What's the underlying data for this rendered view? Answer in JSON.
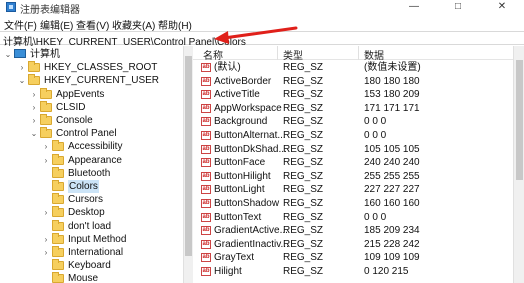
{
  "window": {
    "title": "注册表编辑器",
    "minimize": "—",
    "maximize": "□",
    "close": "✕"
  },
  "menu": [
    "文件(F)",
    "编辑(E)",
    "查看(V)",
    "收藏夹(A)",
    "帮助(H)"
  ],
  "address": "计算机\\HKEY_CURRENT_USER\\Control Panel\\Colors",
  "accent": {
    "selection": "#cce4f7",
    "arrow": "#e0201a"
  },
  "icons": {
    "computer": "computer-icon",
    "folder": "folder-icon",
    "value": "string-value-icon"
  },
  "tree": [
    {
      "label": "计算机",
      "expander": "⌄",
      "icon": "computer"
    },
    {
      "label": "HKEY_CLASSES_ROOT",
      "expander": "›",
      "icon": "folder"
    },
    {
      "label": "HKEY_CURRENT_USER",
      "expander": "⌄",
      "icon": "folder"
    },
    {
      "label": "AppEvents",
      "expander": "›",
      "icon": "folder"
    },
    {
      "label": "CLSID",
      "expander": "›",
      "icon": "folder"
    },
    {
      "label": "Console",
      "expander": "›",
      "icon": "folder"
    },
    {
      "label": "Control Panel",
      "expander": "⌄",
      "icon": "folder"
    },
    {
      "label": "Accessibility",
      "expander": "›",
      "icon": "folder"
    },
    {
      "label": "Appearance",
      "expander": "›",
      "icon": "folder"
    },
    {
      "label": "Bluetooth",
      "expander": "",
      "icon": "folder"
    },
    {
      "label": "Colors",
      "expander": "",
      "icon": "folder",
      "selected": true
    },
    {
      "label": "Cursors",
      "expander": "",
      "icon": "folder"
    },
    {
      "label": "Desktop",
      "expander": "›",
      "icon": "folder"
    },
    {
      "label": "don't load",
      "expander": "",
      "icon": "folder"
    },
    {
      "label": "Input Method",
      "expander": "›",
      "icon": "folder"
    },
    {
      "label": "International",
      "expander": "›",
      "icon": "folder"
    },
    {
      "label": "Keyboard",
      "expander": "",
      "icon": "folder"
    },
    {
      "label": "Mouse",
      "expander": "",
      "icon": "folder"
    }
  ],
  "columns": {
    "name": "名称",
    "type": "类型",
    "data": "数据"
  },
  "values": [
    {
      "name": "(默认)",
      "type": "REG_SZ",
      "data": "(数值未设置)"
    },
    {
      "name": "ActiveBorder",
      "type": "REG_SZ",
      "data": "180 180 180"
    },
    {
      "name": "ActiveTitle",
      "type": "REG_SZ",
      "data": "153 180 209"
    },
    {
      "name": "AppWorkspace",
      "type": "REG_SZ",
      "data": "171 171 171"
    },
    {
      "name": "Background",
      "type": "REG_SZ",
      "data": "0 0 0"
    },
    {
      "name": "ButtonAlternat...",
      "type": "REG_SZ",
      "data": "0 0 0"
    },
    {
      "name": "ButtonDkShad...",
      "type": "REG_SZ",
      "data": "105 105 105"
    },
    {
      "name": "ButtonFace",
      "type": "REG_SZ",
      "data": "240 240 240"
    },
    {
      "name": "ButtonHilight",
      "type": "REG_SZ",
      "data": "255 255 255"
    },
    {
      "name": "ButtonLight",
      "type": "REG_SZ",
      "data": "227 227 227"
    },
    {
      "name": "ButtonShadow",
      "type": "REG_SZ",
      "data": "160 160 160"
    },
    {
      "name": "ButtonText",
      "type": "REG_SZ",
      "data": "0 0 0"
    },
    {
      "name": "GradientActive...",
      "type": "REG_SZ",
      "data": "185 209 234"
    },
    {
      "name": "GradientInactiv...",
      "type": "REG_SZ",
      "data": "215 228 242"
    },
    {
      "name": "GrayText",
      "type": "REG_SZ",
      "data": "109 109 109"
    },
    {
      "name": "Hilight",
      "type": "REG_SZ",
      "data": "0 120 215"
    }
  ]
}
